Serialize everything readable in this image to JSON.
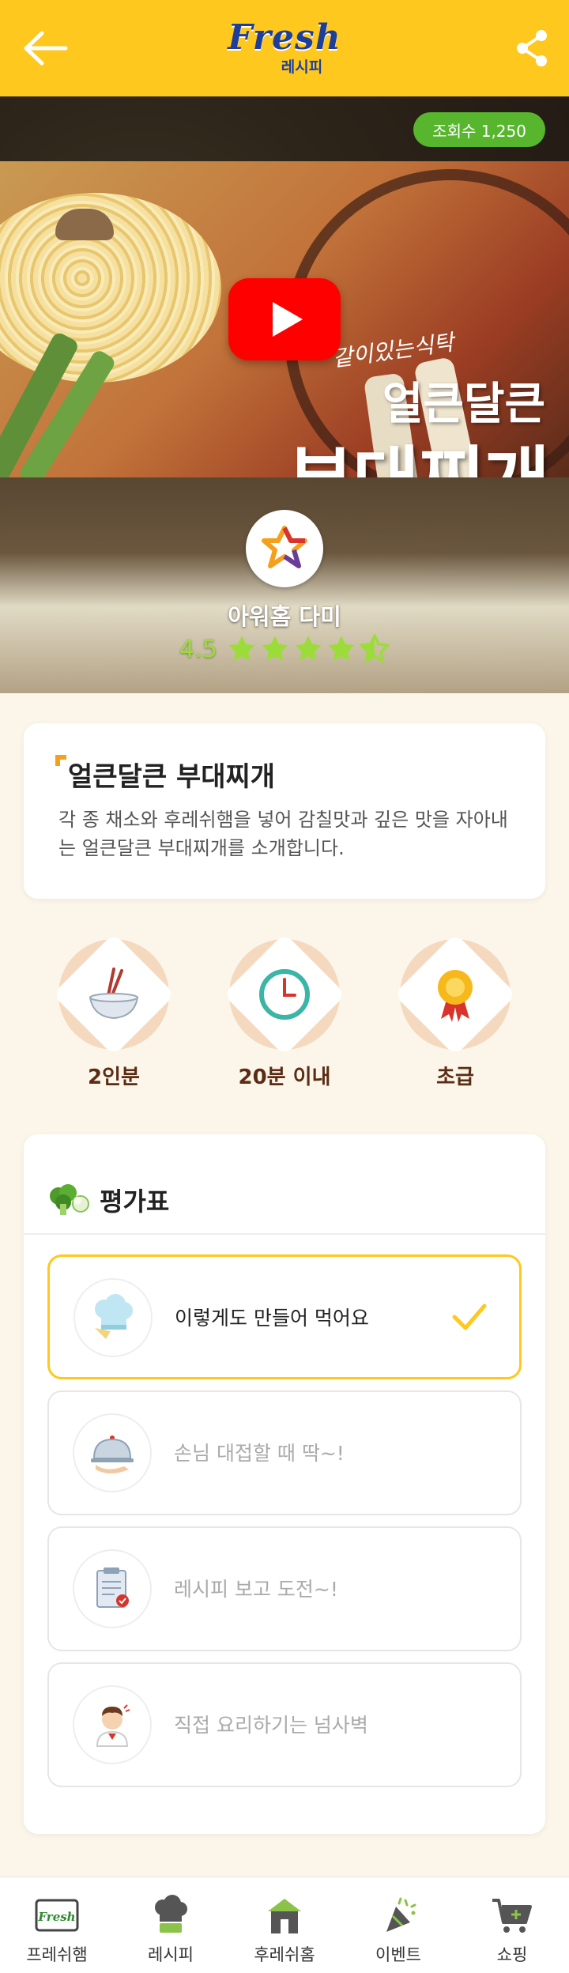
{
  "header": {
    "logo_main": "Fresh",
    "logo_sub": "레시피"
  },
  "hero": {
    "views_label": "조회수 1,250",
    "thumb_tag": "같이있는식탁",
    "thumb_title_line1": "얼큰달큰",
    "thumb_title_line2": "부대찌개",
    "author_name": "아워홈 다미",
    "rating_value": "4.5",
    "rating_stars": 4.5
  },
  "intro": {
    "title": "얼큰달큰 부대찌개",
    "description": "각 종 채소와 후레쉬햄을 넣어 감칠맛과 깊은 맛을 자아내는 얼큰달큰 부대찌개를 소개합니다."
  },
  "info": [
    {
      "icon": "bowl-chopsticks-icon",
      "label": "2인분"
    },
    {
      "icon": "clock-icon",
      "label": "20분 이내"
    },
    {
      "icon": "award-medal-icon",
      "label": "초급"
    }
  ],
  "evaluation": {
    "title": "평가표",
    "options": [
      {
        "icon": "chef-hat-icon",
        "label": "이렇게도 만들어 먹어요",
        "selected": true
      },
      {
        "icon": "serving-cloche-icon",
        "label": "손님 대접할 때 딱~!",
        "selected": false
      },
      {
        "icon": "recipe-clipboard-icon",
        "label": "레시피 보고 도전~!",
        "selected": false
      },
      {
        "icon": "chef-person-icon",
        "label": "직접 요리하기는 넘사벽",
        "selected": false
      }
    ]
  },
  "bottom_nav": [
    {
      "icon": "fresh-ham-icon",
      "label": "프레쉬햄"
    },
    {
      "icon": "recipe-chef-icon",
      "label": "레시피"
    },
    {
      "icon": "home-icon",
      "label": "후레쉬홈"
    },
    {
      "icon": "event-party-icon",
      "label": "이벤트"
    },
    {
      "icon": "shopping-cart-icon",
      "label": "쇼핑"
    }
  ],
  "colors": {
    "brand_yellow": "#ffc81e",
    "brand_blue": "#1d3f9b",
    "views_green": "#58b62e",
    "rating_green": "#9cdc3a",
    "youtube_red": "#ff0000",
    "info_brown": "#5a2c14"
  }
}
